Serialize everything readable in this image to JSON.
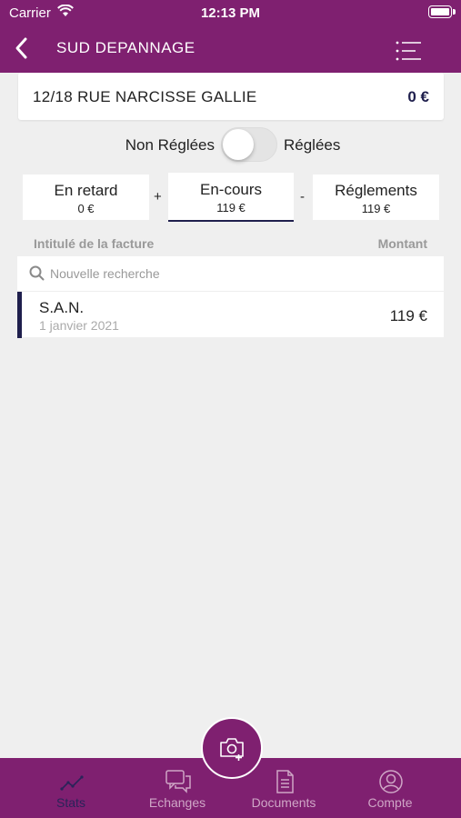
{
  "status_bar": {
    "carrier": "Carrier",
    "time": "12:13 PM"
  },
  "nav": {
    "title": "SUD DEPANNAGE"
  },
  "address": {
    "text": "12/18 RUE NARCISSE GALLIE",
    "amount": "0 €"
  },
  "filter": {
    "left_label": "Non Réglées",
    "right_label": "Réglées",
    "toggle_on": false
  },
  "summary": {
    "late": {
      "label": "En retard",
      "value": "0 €"
    },
    "plus": "+",
    "current": {
      "label": "En-cours",
      "value": "119 €"
    },
    "minus": "-",
    "payments": {
      "label": "Réglements",
      "value": "119 €"
    }
  },
  "columns": {
    "title": "Intitulé de la facture",
    "amount": "Montant"
  },
  "search": {
    "placeholder": "Nouvelle recherche",
    "value": ""
  },
  "invoices": [
    {
      "name": "S.A.N.",
      "date": "1 janvier 2021",
      "amount": "119 €"
    }
  ],
  "tabs": [
    {
      "label": "Stats",
      "icon": "stats-icon",
      "active": true
    },
    {
      "label": "Echanges",
      "icon": "chat-icon",
      "active": false
    },
    {
      "label": "Documents",
      "icon": "document-icon",
      "active": false
    },
    {
      "label": "Compte",
      "icon": "account-icon",
      "active": false
    }
  ],
  "fab": {
    "icon": "camera-add-icon"
  },
  "colors": {
    "primary": "#7f2070",
    "accent": "#1f1f4d",
    "background": "#efefef"
  }
}
